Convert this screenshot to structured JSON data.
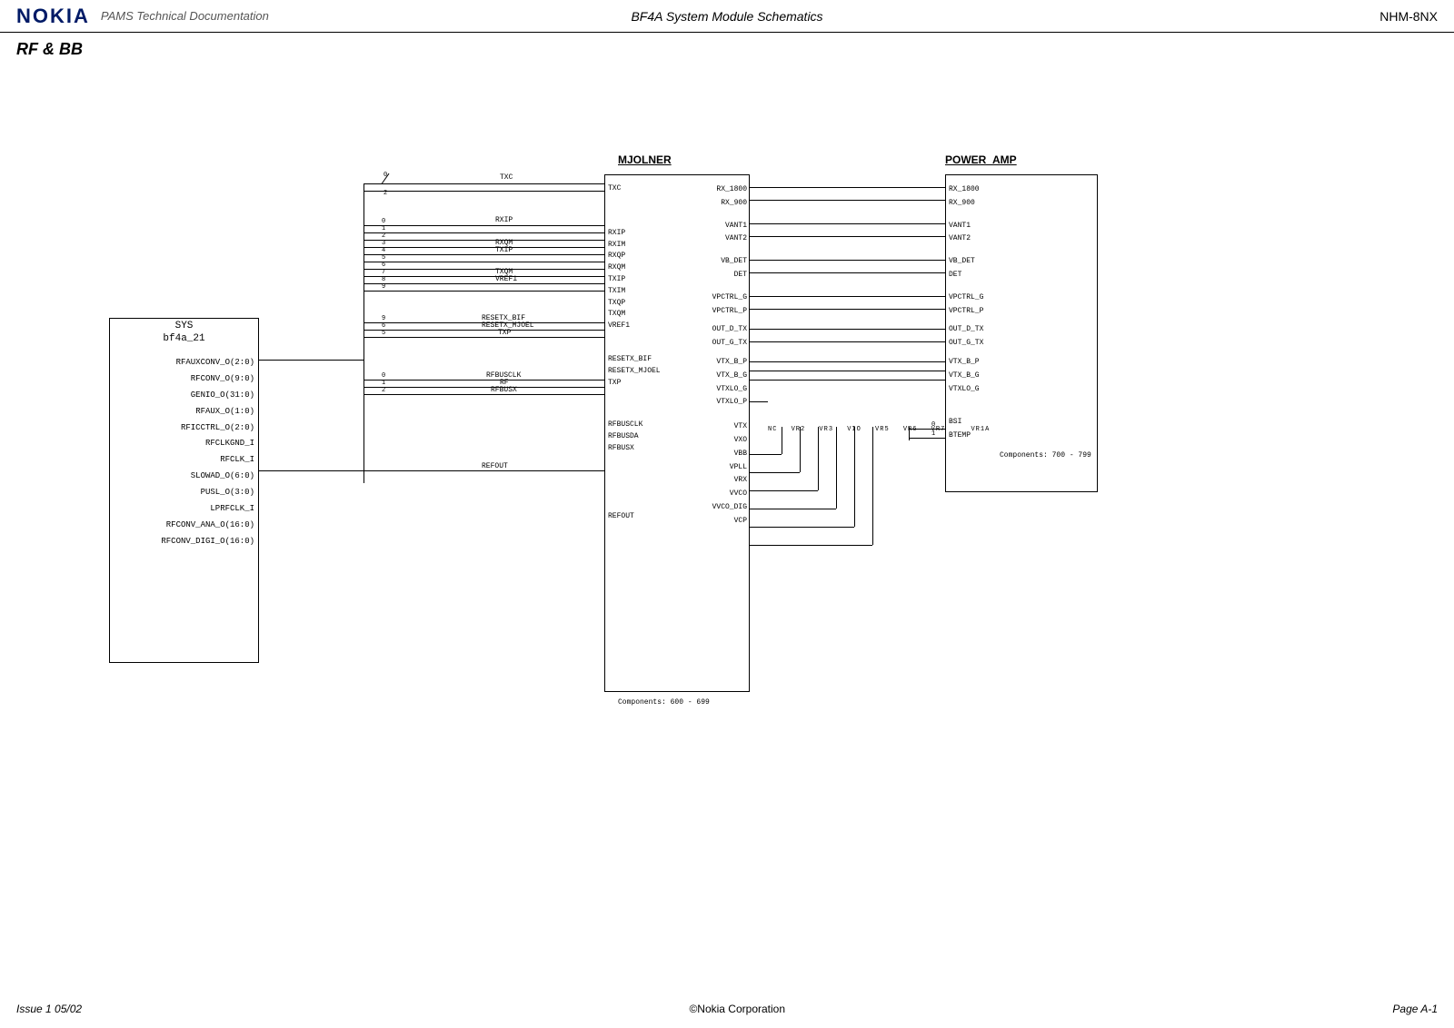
{
  "header": {
    "logo": "NOKIA",
    "pams": "PAMS Technical Documentation",
    "center": "BF4A System Module Schematics",
    "right": "NHM-8NX"
  },
  "section_title": "RF & BB",
  "footer": {
    "left": "Issue 1 05/02",
    "center": "©Nokia Corporation",
    "right": "Page A-1"
  },
  "sys_block": {
    "title_line1": "SYS",
    "title_line2": "bf4a_21",
    "ports": [
      "RFAUXCONV_O(2:0)",
      "RFCONV_O(9:0)",
      "GENIO_O(31:0)",
      "RFAUX_O(1:0)",
      "RFICCTRL_O(2:0)",
      "RFCLKGND_I",
      "RFCLK_I",
      "SLOWAD_O(6:0)",
      "PUSL_O(3:0)",
      "LPRFCLK_I",
      "RFCONV_ANA_O(16:0)",
      "RFCONV_DIGI_O(16:0)"
    ]
  },
  "net_mid": {
    "top_nums_a": [
      "0",
      "2"
    ],
    "top_nums_b": [
      "0",
      "1",
      "2",
      "3",
      "4",
      "5",
      "6",
      "7",
      "8",
      "9"
    ],
    "nets1": "TXC",
    "nets2": "RXIP",
    "nets3": "RXQM",
    "nets4": "TXIP",
    "nets5": "TXQM",
    "nets6": "VREF1",
    "nets7": "RESETX_BIF",
    "nets8": "RESETX_MJOEL",
    "nets9": "TXP",
    "nets10": "RFBUSCLK",
    "nets11": "RF",
    "nets12": "RFBUSX",
    "nets13": "REFOUT",
    "bus_nums_mid": [
      "9",
      "6",
      "5"
    ],
    "bus_nums_rfbus": [
      "0",
      "1",
      "2"
    ]
  },
  "mjolner": {
    "title": "MJOLNER",
    "left_lines": [
      "TXC",
      "",
      "RXIP",
      "RXIM",
      "RXQP",
      "RXQM",
      "TXIP",
      "TXIM",
      "TXQP",
      "TXQM",
      "VREF1",
      "",
      "RESETX_BIF",
      "RESETX_MJOEL",
      "TXP",
      "",
      "RFBUSCLK",
      "RFBUSDA",
      "RFBUSX",
      "",
      "",
      "",
      "",
      "REFOUT"
    ],
    "right": [
      "RX_1800",
      "RX_900",
      "",
      "VANT1",
      "VANT2",
      "",
      "VB_DET",
      "DET",
      "",
      "VPCTRL_G",
      "VPCTRL_P",
      "",
      "OUT_D_TX",
      "OUT_G_TX",
      "",
      "VTX_B_P",
      "VTX_B_G",
      "VTXLO_G",
      "VTXLO_P",
      "",
      "VTX",
      "VXO",
      "VBB",
      "VPLL",
      "VRX",
      "VVCO",
      "VVCO_DIG",
      "VCP"
    ],
    "components": "Components: 600 - 699"
  },
  "vr_labels": [
    "NC",
    "VR2",
    "VR3",
    "VIO",
    "VR5",
    "VR6",
    "VR7",
    "VR1A"
  ],
  "power_amp": {
    "title": "POWER_AMP",
    "left": [
      "RX_1800",
      "RX_900",
      "",
      "VANT1",
      "VANT2",
      "",
      "VB_DET",
      "DET",
      "",
      "VPCTRL_G",
      "VPCTRL_P",
      "",
      "OUT_D_TX",
      "OUT_G_TX",
      "",
      "VTX_B_P",
      "VTX_B_G",
      "VTXLO_G",
      "",
      "",
      "BSI",
      "BTEMP"
    ],
    "bus_nums": [
      "0",
      "1"
    ],
    "components": "Components: 700 - 799"
  }
}
